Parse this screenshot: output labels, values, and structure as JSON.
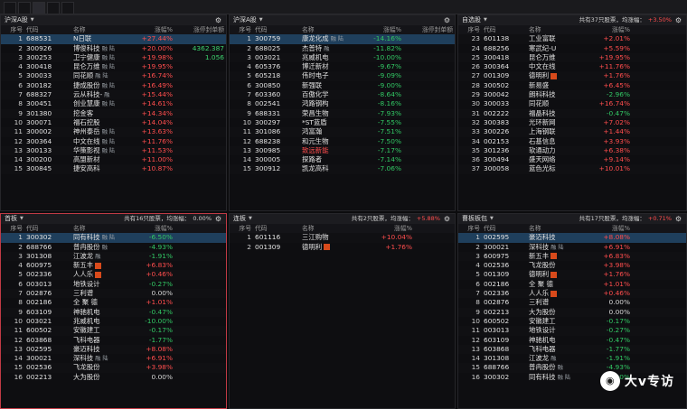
{
  "topbar": {
    "tabs": [
      "",
      "",
      "",
      "",
      "",
      ""
    ]
  },
  "tabrow": [
    "综合",
    "2图",
    "4图",
    "6图",
    "9图"
  ],
  "columns": {
    "seq": "序号",
    "code": "代码",
    "name": "名称",
    "chg": "涨幅%",
    "extra": "涨停封单额"
  },
  "panels": {
    "p1": {
      "title": "沪深A股",
      "extra_header": "涨停封单额",
      "rows": [
        {
          "seq": "1",
          "code": "688531",
          "name": "N日联",
          "tag": "",
          "chg": "+27.44%",
          "dir": "up",
          "extra": "",
          "hl": true
        },
        {
          "seq": "2",
          "code": "300926",
          "name": "博俊科技",
          "tag": "融 陆",
          "chg": "+20.00%",
          "dir": "up",
          "extra": "4362.387"
        },
        {
          "seq": "3",
          "code": "300253",
          "name": "卫宁健康",
          "tag": "融 陆",
          "chg": "+19.98%",
          "dir": "up",
          "extra": "1.056"
        },
        {
          "seq": "4",
          "code": "300418",
          "name": "昆仑万维",
          "tag": "融 陆",
          "chg": "+19.95%",
          "dir": "up",
          "extra": ""
        },
        {
          "seq": "5",
          "code": "300033",
          "name": "同花顺",
          "tag": "融 陆",
          "chg": "+16.74%",
          "dir": "up",
          "extra": ""
        },
        {
          "seq": "6",
          "code": "300182",
          "name": "捷成股份",
          "tag": "融 陆",
          "chg": "+16.49%",
          "dir": "up",
          "extra": ""
        },
        {
          "seq": "7",
          "code": "688327",
          "name": "云从科技-",
          "tag": "融",
          "chg": "+15.44%",
          "dir": "up",
          "extra": ""
        },
        {
          "seq": "8",
          "code": "300451",
          "name": "创业慧康",
          "tag": "融 陆",
          "chg": "+14.61%",
          "dir": "up",
          "extra": ""
        },
        {
          "seq": "9",
          "code": "301380",
          "name": "挖金客",
          "tag": "",
          "chg": "+14.34%",
          "dir": "up",
          "extra": ""
        },
        {
          "seq": "10",
          "code": "300071",
          "name": "福石控股",
          "tag": "",
          "chg": "+14.04%",
          "dir": "up",
          "extra": ""
        },
        {
          "seq": "11",
          "code": "300002",
          "name": "神州泰岳",
          "tag": "融 陆",
          "chg": "+13.63%",
          "dir": "up",
          "extra": ""
        },
        {
          "seq": "12",
          "code": "300364",
          "name": "中文在线",
          "tag": "融 陆",
          "chg": "+11.76%",
          "dir": "up",
          "extra": ""
        },
        {
          "seq": "13",
          "code": "300133",
          "name": "华策影视",
          "tag": "融 陆",
          "chg": "+11.53%",
          "dir": "up",
          "extra": ""
        },
        {
          "seq": "14",
          "code": "300200",
          "name": "高盟新材",
          "tag": "",
          "chg": "+11.00%",
          "dir": "up",
          "extra": ""
        },
        {
          "seq": "15",
          "code": "300845",
          "name": "捷安高科",
          "tag": "",
          "chg": "+10.87%",
          "dir": "up",
          "extra": ""
        }
      ]
    },
    "p2": {
      "title": "沪深A股",
      "rows": [
        {
          "seq": "1",
          "code": "300759",
          "name": "康龙化成",
          "tag": "融 陆",
          "chg": "-14.16%",
          "dir": "down",
          "hl": true
        },
        {
          "seq": "2",
          "code": "688025",
          "name": "杰普特",
          "tag": "融",
          "chg": "-11.82%",
          "dir": "down"
        },
        {
          "seq": "3",
          "code": "003021",
          "name": "兆威机电",
          "tag": "",
          "chg": "-10.00%",
          "dir": "down"
        },
        {
          "seq": "4",
          "code": "605376",
          "name": "博迁新材",
          "tag": "",
          "chg": "-9.67%",
          "dir": "down"
        },
        {
          "seq": "5",
          "code": "605218",
          "name": "伟时电子",
          "tag": "",
          "chg": "-9.09%",
          "dir": "down"
        },
        {
          "seq": "6",
          "code": "300850",
          "name": "新强联",
          "tag": "",
          "chg": "-9.00%",
          "dir": "down"
        },
        {
          "seq": "7",
          "code": "603360",
          "name": "百傲化学",
          "tag": "",
          "chg": "-8.64%",
          "dir": "down"
        },
        {
          "seq": "8",
          "code": "002541",
          "name": "鸿路钢构",
          "tag": "",
          "chg": "-8.16%",
          "dir": "down"
        },
        {
          "seq": "9",
          "code": "688331",
          "name": "荣昌生物",
          "tag": "",
          "chg": "-7.93%",
          "dir": "down"
        },
        {
          "seq": "10",
          "code": "300297",
          "name": "*ST蓝盾",
          "tag": "",
          "chg": "-7.55%",
          "dir": "down"
        },
        {
          "seq": "11",
          "code": "301086",
          "name": "鸿富瀚",
          "tag": "",
          "chg": "-7.51%",
          "dir": "down"
        },
        {
          "seq": "12",
          "code": "688238",
          "name": "和元生物",
          "tag": "",
          "chg": "-7.50%",
          "dir": "down"
        },
        {
          "seq": "13",
          "code": "300985",
          "name": "致远新能",
          "tag": "",
          "chg": "-7.17%",
          "dir": "down",
          "namecolor": "up"
        },
        {
          "seq": "14",
          "code": "300005",
          "name": "探路者",
          "tag": "",
          "chg": "-7.14%",
          "dir": "down"
        },
        {
          "seq": "15",
          "code": "300912",
          "name": "凯龙高科",
          "tag": "",
          "chg": "-7.06%",
          "dir": "down"
        }
      ]
    },
    "p3": {
      "title": "自选股",
      "summary": "共有37只股票，均涨幅：",
      "summary_val": "+3.50%",
      "rows": [
        {
          "seq": "23",
          "code": "601138",
          "name": "工业富联",
          "tag": "",
          "chg": "+2.01%",
          "dir": "up"
        },
        {
          "seq": "24",
          "code": "688256",
          "name": "寒武纪-U",
          "tag": "",
          "chg": "+5.59%",
          "dir": "up"
        },
        {
          "seq": "25",
          "code": "300418",
          "name": "昆仑万维",
          "tag": "",
          "chg": "+19.95%",
          "dir": "up"
        },
        {
          "seq": "26",
          "code": "300364",
          "name": "中文在线",
          "tag": "",
          "chg": "+11.76%",
          "dir": "up"
        },
        {
          "seq": "27",
          "code": "001309",
          "name": "德明利",
          "tag": "",
          "rz": true,
          "chg": "+1.76%",
          "dir": "up"
        },
        {
          "seq": "28",
          "code": "300502",
          "name": "新易盛",
          "tag": "",
          "chg": "+6.45%",
          "dir": "up"
        },
        {
          "seq": "29",
          "code": "300042",
          "name": "朗科科技",
          "tag": "",
          "chg": "-2.96%",
          "dir": "down"
        },
        {
          "seq": "30",
          "code": "300033",
          "name": "同花顺",
          "tag": "",
          "chg": "+16.74%",
          "dir": "up"
        },
        {
          "seq": "31",
          "code": "002222",
          "name": "福晶科技",
          "tag": "",
          "chg": "-0.47%",
          "dir": "down"
        },
        {
          "seq": "32",
          "code": "300383",
          "name": "光环新网",
          "tag": "",
          "chg": "+7.02%",
          "dir": "up"
        },
        {
          "seq": "33",
          "code": "300226",
          "name": "上海钢联",
          "tag": "",
          "chg": "+1.44%",
          "dir": "up"
        },
        {
          "seq": "34",
          "code": "002153",
          "name": "石基信息",
          "tag": "",
          "chg": "+3.93%",
          "dir": "up"
        },
        {
          "seq": "35",
          "code": "301236",
          "name": "软通动力",
          "tag": "",
          "chg": "+6.38%",
          "dir": "up"
        },
        {
          "seq": "36",
          "code": "300494",
          "name": "盛天网络",
          "tag": "",
          "chg": "+9.14%",
          "dir": "up"
        },
        {
          "seq": "37",
          "code": "300058",
          "name": "蓝色光标",
          "tag": "",
          "chg": "+10.01%",
          "dir": "up"
        }
      ]
    },
    "p4": {
      "title": "首板",
      "summary": "共有16只股票，均涨幅：",
      "summary_val": "0.00%",
      "rows": [
        {
          "seq": "1",
          "code": "300302",
          "name": "同有科技",
          "tag": "融 陆",
          "chg": "-6.50%",
          "dir": "down",
          "hl": true
        },
        {
          "seq": "2",
          "code": "688766",
          "name": "普冉股份",
          "tag": "融",
          "chg": "-4.93%",
          "dir": "down"
        },
        {
          "seq": "3",
          "code": "301308",
          "name": "江波龙",
          "tag": "融",
          "chg": "-1.91%",
          "dir": "down"
        },
        {
          "seq": "4",
          "code": "600975",
          "name": "新五丰",
          "tag": "",
          "rz": true,
          "chg": "+6.83%",
          "dir": "up"
        },
        {
          "seq": "5",
          "code": "002336",
          "name": "人人乐",
          "tag": "",
          "rz": true,
          "chg": "+0.46%",
          "dir": "up"
        },
        {
          "seq": "6",
          "code": "003013",
          "name": "地铁设计",
          "tag": "",
          "chg": "-0.27%",
          "dir": "down"
        },
        {
          "seq": "7",
          "code": "002876",
          "name": "三利谱",
          "tag": "",
          "chg": "0.00%",
          "dir": "flat"
        },
        {
          "seq": "8",
          "code": "002186",
          "name": "全 聚 德",
          "tag": "",
          "chg": "+1.01%",
          "dir": "up"
        },
        {
          "seq": "9",
          "code": "603109",
          "name": "神驰机电",
          "tag": "",
          "chg": "-0.47%",
          "dir": "down"
        },
        {
          "seq": "10",
          "code": "003021",
          "name": "兆威机电",
          "tag": "",
          "chg": "-10.00%",
          "dir": "down"
        },
        {
          "seq": "11",
          "code": "600502",
          "name": "安徽建工",
          "tag": "",
          "chg": "-0.17%",
          "dir": "down"
        },
        {
          "seq": "12",
          "code": "603868",
          "name": "飞科电器",
          "tag": "",
          "chg": "-1.77%",
          "dir": "down"
        },
        {
          "seq": "13",
          "code": "002595",
          "name": "豪迈科技",
          "tag": "",
          "chg": "+8.08%",
          "dir": "up"
        },
        {
          "seq": "14",
          "code": "300021",
          "name": "深科技",
          "tag": "融 陆",
          "chg": "+6.91%",
          "dir": "up"
        },
        {
          "seq": "15",
          "code": "002536",
          "name": "飞龙股份",
          "tag": "",
          "chg": "+3.98%",
          "dir": "up"
        },
        {
          "seq": "16",
          "code": "002213",
          "name": "大为股份",
          "tag": "",
          "chg": "0.00%",
          "dir": "flat"
        }
      ]
    },
    "p5": {
      "title": "连板",
      "summary": "共有2只股票，均涨幅：",
      "summary_val": "+5.88%",
      "rows": [
        {
          "seq": "1",
          "code": "601116",
          "name": "三江购物",
          "tag": "",
          "chg": "+10.04%",
          "dir": "up"
        },
        {
          "seq": "2",
          "code": "001309",
          "name": "德明利",
          "tag": "",
          "rz": true,
          "chg": "+1.76%",
          "dir": "up"
        }
      ]
    },
    "p6": {
      "title": "曹板板包",
      "summary": "共有17只股票，均涨幅：",
      "summary_val": "+0.71%",
      "rows": [
        {
          "seq": "1",
          "code": "002595",
          "name": "豪迈科技",
          "tag": "",
          "chg": "+8.08%",
          "dir": "up",
          "hl": true
        },
        {
          "seq": "2",
          "code": "300021",
          "name": "深科技",
          "tag": "融 陆",
          "chg": "+6.91%",
          "dir": "up"
        },
        {
          "seq": "3",
          "code": "600975",
          "name": "新五丰",
          "tag": "",
          "rz": true,
          "chg": "+6.83%",
          "dir": "up"
        },
        {
          "seq": "4",
          "code": "002536",
          "name": "飞龙股份",
          "tag": "",
          "chg": "+3.98%",
          "dir": "up"
        },
        {
          "seq": "5",
          "code": "001309",
          "name": "德明利",
          "tag": "",
          "rz": true,
          "chg": "+1.76%",
          "dir": "up"
        },
        {
          "seq": "6",
          "code": "002186",
          "name": "全 聚 德",
          "tag": "",
          "chg": "+1.01%",
          "dir": "up"
        },
        {
          "seq": "7",
          "code": "002336",
          "name": "人人乐",
          "tag": "",
          "rz": true,
          "chg": "+0.46%",
          "dir": "up"
        },
        {
          "seq": "8",
          "code": "002876",
          "name": "三利谱",
          "tag": "",
          "chg": "0.00%",
          "dir": "flat"
        },
        {
          "seq": "9",
          "code": "002213",
          "name": "大为股份",
          "tag": "",
          "chg": "0.00%",
          "dir": "flat"
        },
        {
          "seq": "10",
          "code": "600502",
          "name": "安徽建工",
          "tag": "",
          "chg": "-0.17%",
          "dir": "down"
        },
        {
          "seq": "11",
          "code": "003013",
          "name": "地铁设计",
          "tag": "",
          "chg": "-0.27%",
          "dir": "down"
        },
        {
          "seq": "12",
          "code": "603109",
          "name": "神驰机电",
          "tag": "",
          "chg": "-0.47%",
          "dir": "down"
        },
        {
          "seq": "13",
          "code": "603868",
          "name": "飞科电器",
          "tag": "",
          "chg": "-1.77%",
          "dir": "down"
        },
        {
          "seq": "14",
          "code": "301308",
          "name": "江波龙",
          "tag": "融",
          "chg": "-1.91%",
          "dir": "down"
        },
        {
          "seq": "15",
          "code": "688766",
          "name": "普冉股份",
          "tag": "融",
          "chg": "-4.93%",
          "dir": "down"
        },
        {
          "seq": "16",
          "code": "300302",
          "name": "同有科技",
          "tag": "融 陆",
          "chg": "-6.50%",
          "dir": "down"
        }
      ]
    }
  },
  "watermark": {
    "text": "大v专访",
    "icon": "wechat-icon"
  },
  "colors": {
    "up": "#ff4d4d",
    "down": "#32c864",
    "highlight": "#1f3f5c",
    "selected_border": "#c03a45"
  }
}
